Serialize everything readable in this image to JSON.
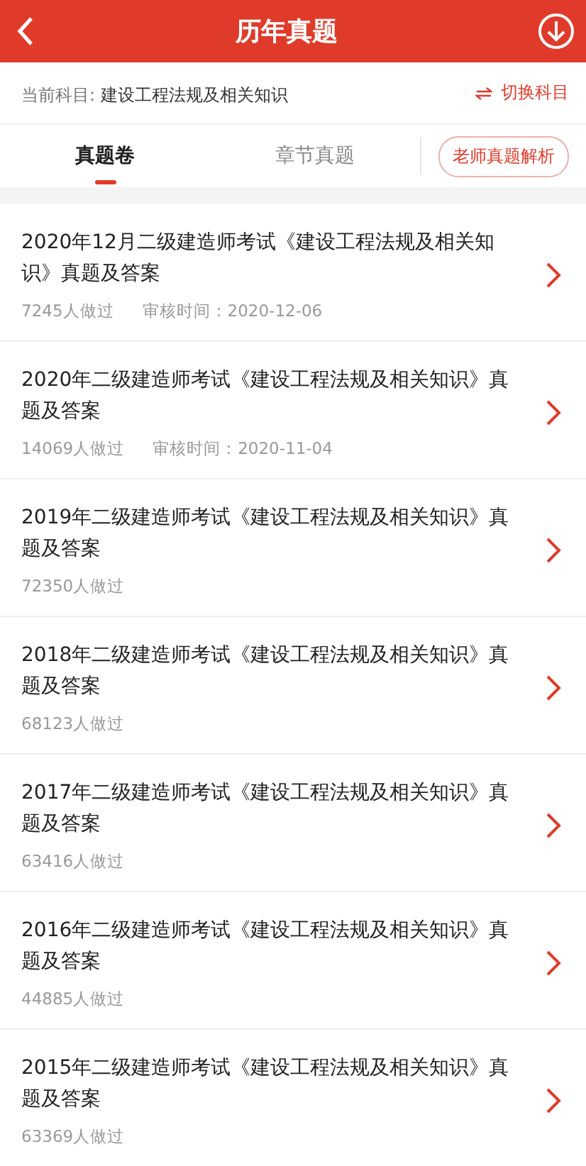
{
  "header": {
    "title": "历年真题"
  },
  "subject_bar": {
    "label": "当前科目:",
    "subject": "建设工程法规及相关知识",
    "switch_label": "切换科目"
  },
  "tabs": [
    {
      "label": "真题卷",
      "selected": true
    },
    {
      "label": "章节真题",
      "selected": false
    }
  ],
  "teacher_button": "老师真题解析",
  "papers": [
    {
      "title": "2020年12月二级建造师考试《建设工程法规及相关知识》真题及答案",
      "done": "7245人做过",
      "review": "审核时间：2020-12-06"
    },
    {
      "title": "2020年二级建造师考试《建设工程法规及相关知识》真题及答案",
      "done": "14069人做过",
      "review": "审核时间：2020-11-04"
    },
    {
      "title": "2019年二级建造师考试《建设工程法规及相关知识》真题及答案",
      "done": "72350人做过"
    },
    {
      "title": "2018年二级建造师考试《建设工程法规及相关知识》真题及答案",
      "done": "68123人做过"
    },
    {
      "title": "2017年二级建造师考试《建设工程法规及相关知识》真题及答案",
      "done": "63416人做过"
    },
    {
      "title": "2016年二级建造师考试《建设工程法规及相关知识》真题及答案",
      "done": "44885人做过"
    },
    {
      "title": "2015年二级建造师考试《建设工程法规及相关知识》真题及答案",
      "done": "63369人做过"
    }
  ]
}
